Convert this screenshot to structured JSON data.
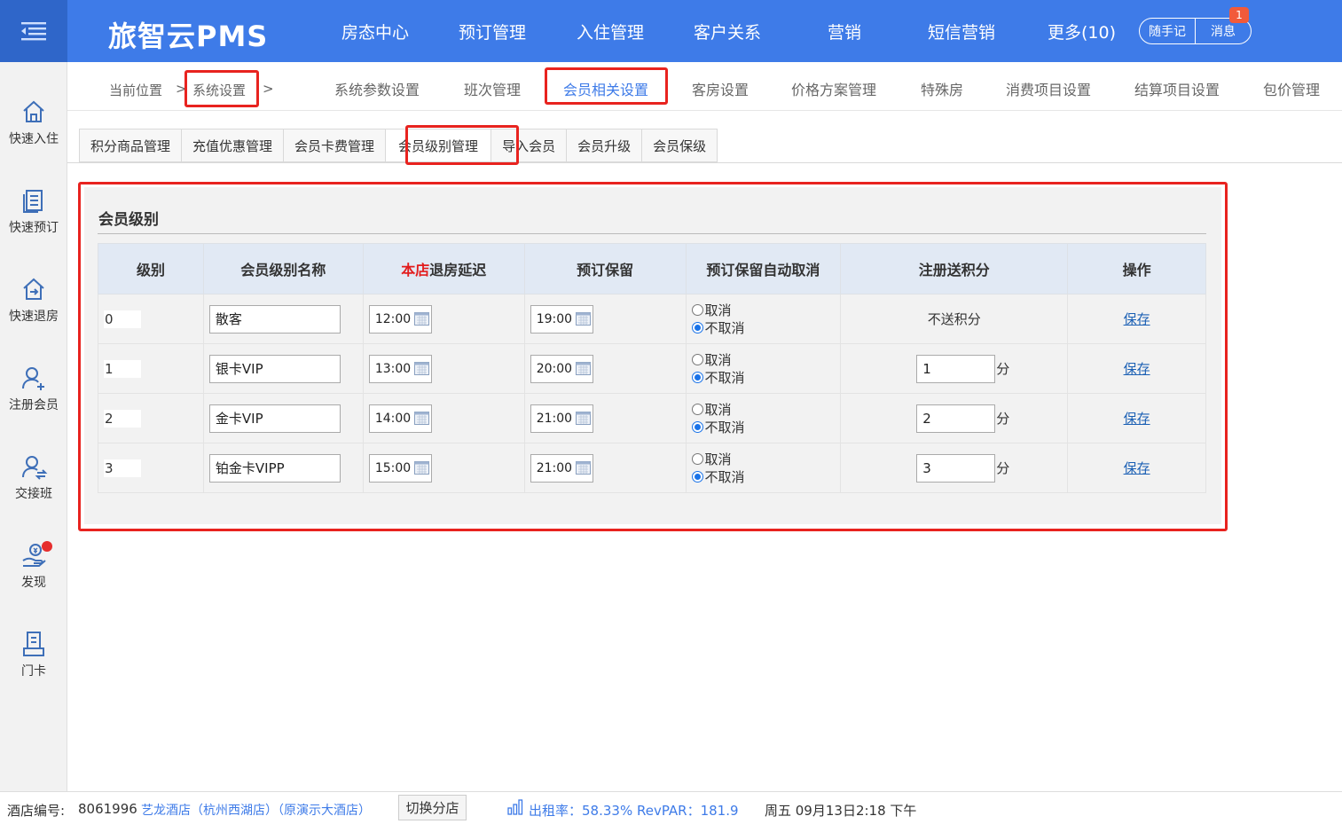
{
  "app": {
    "title": "旅智云PMS"
  },
  "top_nav": [
    "房态中心",
    "预订管理",
    "入住管理",
    "客户关系",
    "营销",
    "短信营销",
    "更多(10)"
  ],
  "top_buttons": {
    "notes": "随手记",
    "messages": "消息",
    "message_count": "1"
  },
  "sidebar": [
    "快速入住",
    "快速预订",
    "快速退房",
    "注册会员",
    "交接班",
    "发现",
    "门卡"
  ],
  "breadcrumb": {
    "label": "当前位置",
    "sep": ">",
    "current": "系统设置",
    "sep2": ">"
  },
  "settings_tabs": [
    "系统参数设置",
    "班次管理",
    "会员相关设置",
    "客房设置",
    "价格方案管理",
    "特殊房",
    "消费项目设置",
    "结算项目设置",
    "包价管理"
  ],
  "member_tabs": [
    "积分商品管理",
    "充值优惠管理",
    "会员卡费管理",
    "会员级别管理",
    "导入会员",
    "会员升级",
    "会员保级"
  ],
  "panel": {
    "title": "会员级别"
  },
  "table": {
    "headers": {
      "level": "级别",
      "name": "会员级别名称",
      "checkout_red": "本店",
      "checkout_rest": "退房延迟",
      "reserve_hold": "预订保留",
      "auto_cancel": "预订保留自动取消",
      "points": "注册送积分",
      "action": "操作"
    },
    "rows": [
      {
        "level": "0",
        "name": "散客",
        "checkout": "12:00",
        "hold": "19:00",
        "opt_cancel": "取消",
        "opt_keep": "不取消",
        "points_text": "不送积分",
        "action": "保存"
      },
      {
        "level": "1",
        "name": "银卡VIP",
        "checkout": "13:00",
        "hold": "20:00",
        "opt_cancel": "取消",
        "opt_keep": "不取消",
        "points": "1",
        "unit": "分",
        "action": "保存"
      },
      {
        "level": "2",
        "name": "金卡VIP",
        "checkout": "14:00",
        "hold": "21:00",
        "opt_cancel": "取消",
        "opt_keep": "不取消",
        "points": "2",
        "unit": "分",
        "action": "保存"
      },
      {
        "level": "3",
        "name": "铂金卡VIPP",
        "checkout": "15:00",
        "hold": "21:00",
        "opt_cancel": "取消",
        "opt_keep": "不取消",
        "points": "3",
        "unit": "分",
        "action": "保存"
      }
    ]
  },
  "status": {
    "hotel_label": "酒店编号:",
    "hotel_id": "8061996",
    "hotel_name": "艺龙酒店（杭州西湖店）（原演示大酒店）",
    "switch": "切换分店",
    "occupancy": "出租率：58.33% RevPAR：181.9",
    "datetime": "周五 09月13日2:18 下午"
  },
  "colors": {
    "topbar": "#3e7be8",
    "highlight": "#e8231f",
    "link": "#1a5fb4"
  }
}
